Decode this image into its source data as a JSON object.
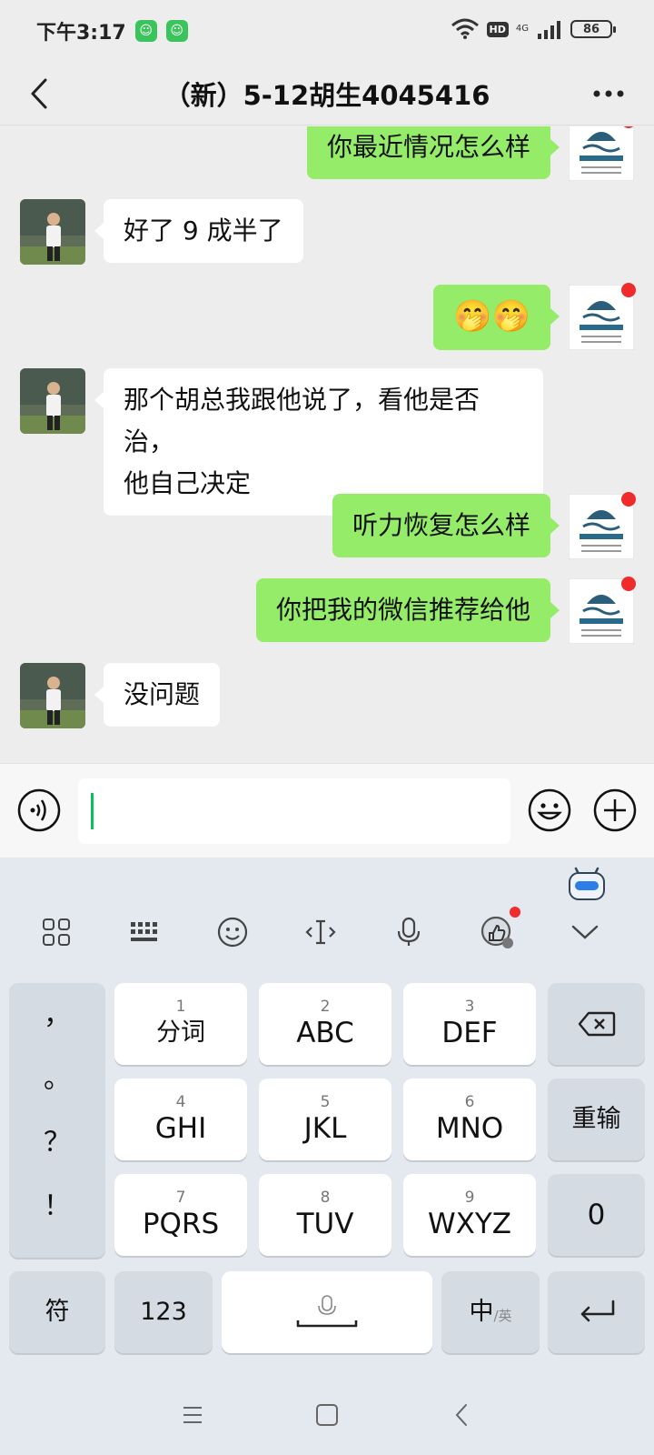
{
  "status_bar": {
    "time": "下午3:17",
    "hd": "HD",
    "network": "4G",
    "battery": "86"
  },
  "header": {
    "title": "（新）5-12胡生4045416"
  },
  "messages": [
    {
      "side": "right",
      "text": "你最近情况怎么样"
    },
    {
      "side": "left",
      "text": "好了 9 成半了"
    },
    {
      "side": "right",
      "text": "🤭🤭"
    },
    {
      "side": "left",
      "text_line1": "那个胡总我跟他说了，看他是否治，",
      "text_line2": "他自己决定"
    },
    {
      "side": "right",
      "text": "听力恢复怎么样"
    },
    {
      "side": "right",
      "text": "你把我的微信推荐给他"
    },
    {
      "side": "left",
      "text": "没问题"
    }
  ],
  "input": {
    "value": ""
  },
  "keyboard": {
    "punctuation": [
      "，",
      "。",
      "？",
      "！"
    ],
    "keys": [
      {
        "num": "1",
        "label": "分词"
      },
      {
        "num": "2",
        "label": "ABC"
      },
      {
        "num": "3",
        "label": "DEF"
      },
      {
        "num": "4",
        "label": "GHI"
      },
      {
        "num": "5",
        "label": "JKL"
      },
      {
        "num": "6",
        "label": "MNO"
      },
      {
        "num": "7",
        "label": "PQRS"
      },
      {
        "num": "8",
        "label": "TUV"
      },
      {
        "num": "9",
        "label": "WXYZ"
      }
    ],
    "reinput": "重输",
    "zero": "0",
    "symbol": "符",
    "numbers": "123",
    "lang_main": "中",
    "lang_sub": "/英"
  },
  "colors": {
    "accent_green": "#95ec69",
    "caret_green": "#07c160",
    "unread_red": "#f02b2b"
  },
  "icons": [
    "back-icon",
    "more-icon",
    "voice-icon",
    "emoji-icon",
    "plus-icon",
    "grid-icon",
    "keyboard-icon",
    "smile-icon",
    "cursor-icon",
    "mic-icon",
    "badge-icon",
    "collapse-icon",
    "backspace-icon",
    "enter-icon",
    "space-mic-icon",
    "nav-menu-icon",
    "nav-home-icon",
    "nav-back-icon"
  ]
}
